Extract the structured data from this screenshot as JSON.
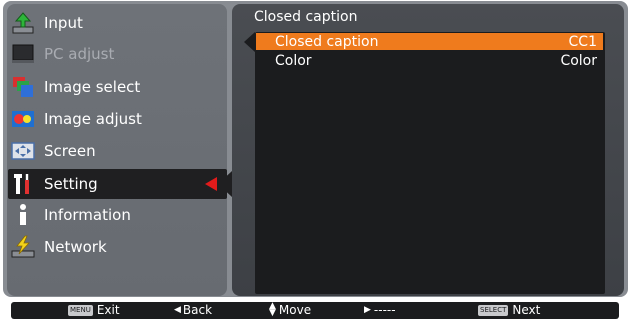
{
  "menu": {
    "items": [
      {
        "label": "Input",
        "icon": "input-icon",
        "dim": false
      },
      {
        "label": "PC adjust",
        "icon": "pc-adjust-icon",
        "dim": true
      },
      {
        "label": "Image select",
        "icon": "image-select-icon",
        "dim": false
      },
      {
        "label": "Image adjust",
        "icon": "image-adjust-icon",
        "dim": false
      },
      {
        "label": "Screen",
        "icon": "screen-icon",
        "dim": false
      },
      {
        "label": "Setting",
        "icon": "setting-icon",
        "dim": false,
        "active": true
      },
      {
        "label": "Information",
        "icon": "information-icon",
        "dim": false
      },
      {
        "label": "Network",
        "icon": "network-icon",
        "dim": false
      }
    ]
  },
  "submenu": {
    "title": "Closed caption",
    "rows": [
      {
        "label": "Closed caption",
        "value": "CC1",
        "selected": true
      },
      {
        "label": "Color",
        "value": "Color",
        "selected": false
      }
    ]
  },
  "bottom_bar": {
    "exit_key": "MENU",
    "exit_label": "Exit",
    "back_label": "Back",
    "move_label": "Move",
    "right_label": "-----",
    "next_key": "SELECT",
    "next_label": "Next"
  },
  "colors": {
    "accent": "#ef7b1d",
    "active_marker": "#e11b1b"
  }
}
